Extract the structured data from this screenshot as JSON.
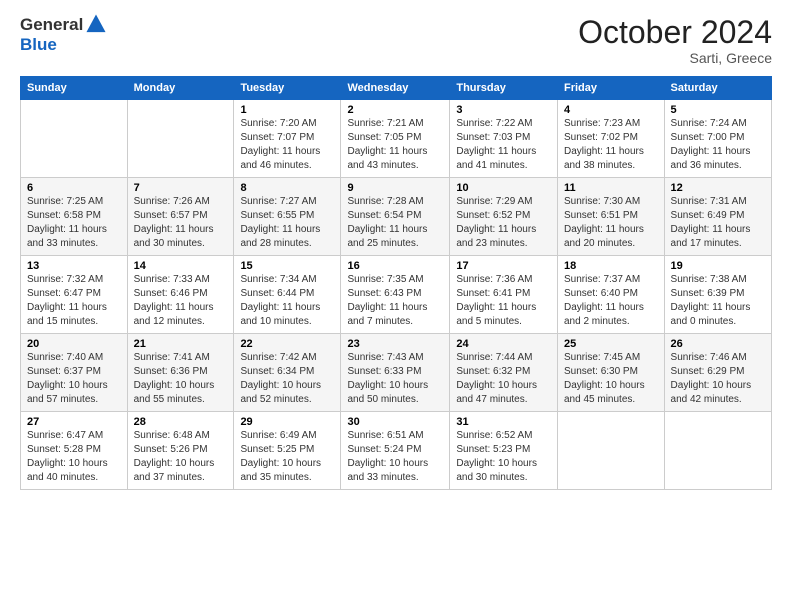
{
  "header": {
    "logo_general": "General",
    "logo_blue": "Blue",
    "title": "October 2024",
    "location": "Sarti, Greece"
  },
  "columns": [
    "Sunday",
    "Monday",
    "Tuesday",
    "Wednesday",
    "Thursday",
    "Friday",
    "Saturday"
  ],
  "weeks": [
    [
      {
        "day": "",
        "info": ""
      },
      {
        "day": "",
        "info": ""
      },
      {
        "day": "1",
        "info": "Sunrise: 7:20 AM\nSunset: 7:07 PM\nDaylight: 11 hours and 46 minutes."
      },
      {
        "day": "2",
        "info": "Sunrise: 7:21 AM\nSunset: 7:05 PM\nDaylight: 11 hours and 43 minutes."
      },
      {
        "day": "3",
        "info": "Sunrise: 7:22 AM\nSunset: 7:03 PM\nDaylight: 11 hours and 41 minutes."
      },
      {
        "day": "4",
        "info": "Sunrise: 7:23 AM\nSunset: 7:02 PM\nDaylight: 11 hours and 38 minutes."
      },
      {
        "day": "5",
        "info": "Sunrise: 7:24 AM\nSunset: 7:00 PM\nDaylight: 11 hours and 36 minutes."
      }
    ],
    [
      {
        "day": "6",
        "info": "Sunrise: 7:25 AM\nSunset: 6:58 PM\nDaylight: 11 hours and 33 minutes."
      },
      {
        "day": "7",
        "info": "Sunrise: 7:26 AM\nSunset: 6:57 PM\nDaylight: 11 hours and 30 minutes."
      },
      {
        "day": "8",
        "info": "Sunrise: 7:27 AM\nSunset: 6:55 PM\nDaylight: 11 hours and 28 minutes."
      },
      {
        "day": "9",
        "info": "Sunrise: 7:28 AM\nSunset: 6:54 PM\nDaylight: 11 hours and 25 minutes."
      },
      {
        "day": "10",
        "info": "Sunrise: 7:29 AM\nSunset: 6:52 PM\nDaylight: 11 hours and 23 minutes."
      },
      {
        "day": "11",
        "info": "Sunrise: 7:30 AM\nSunset: 6:51 PM\nDaylight: 11 hours and 20 minutes."
      },
      {
        "day": "12",
        "info": "Sunrise: 7:31 AM\nSunset: 6:49 PM\nDaylight: 11 hours and 17 minutes."
      }
    ],
    [
      {
        "day": "13",
        "info": "Sunrise: 7:32 AM\nSunset: 6:47 PM\nDaylight: 11 hours and 15 minutes."
      },
      {
        "day": "14",
        "info": "Sunrise: 7:33 AM\nSunset: 6:46 PM\nDaylight: 11 hours and 12 minutes."
      },
      {
        "day": "15",
        "info": "Sunrise: 7:34 AM\nSunset: 6:44 PM\nDaylight: 11 hours and 10 minutes."
      },
      {
        "day": "16",
        "info": "Sunrise: 7:35 AM\nSunset: 6:43 PM\nDaylight: 11 hours and 7 minutes."
      },
      {
        "day": "17",
        "info": "Sunrise: 7:36 AM\nSunset: 6:41 PM\nDaylight: 11 hours and 5 minutes."
      },
      {
        "day": "18",
        "info": "Sunrise: 7:37 AM\nSunset: 6:40 PM\nDaylight: 11 hours and 2 minutes."
      },
      {
        "day": "19",
        "info": "Sunrise: 7:38 AM\nSunset: 6:39 PM\nDaylight: 11 hours and 0 minutes."
      }
    ],
    [
      {
        "day": "20",
        "info": "Sunrise: 7:40 AM\nSunset: 6:37 PM\nDaylight: 10 hours and 57 minutes."
      },
      {
        "day": "21",
        "info": "Sunrise: 7:41 AM\nSunset: 6:36 PM\nDaylight: 10 hours and 55 minutes."
      },
      {
        "day": "22",
        "info": "Sunrise: 7:42 AM\nSunset: 6:34 PM\nDaylight: 10 hours and 52 minutes."
      },
      {
        "day": "23",
        "info": "Sunrise: 7:43 AM\nSunset: 6:33 PM\nDaylight: 10 hours and 50 minutes."
      },
      {
        "day": "24",
        "info": "Sunrise: 7:44 AM\nSunset: 6:32 PM\nDaylight: 10 hours and 47 minutes."
      },
      {
        "day": "25",
        "info": "Sunrise: 7:45 AM\nSunset: 6:30 PM\nDaylight: 10 hours and 45 minutes."
      },
      {
        "day": "26",
        "info": "Sunrise: 7:46 AM\nSunset: 6:29 PM\nDaylight: 10 hours and 42 minutes."
      }
    ],
    [
      {
        "day": "27",
        "info": "Sunrise: 6:47 AM\nSunset: 5:28 PM\nDaylight: 10 hours and 40 minutes."
      },
      {
        "day": "28",
        "info": "Sunrise: 6:48 AM\nSunset: 5:26 PM\nDaylight: 10 hours and 37 minutes."
      },
      {
        "day": "29",
        "info": "Sunrise: 6:49 AM\nSunset: 5:25 PM\nDaylight: 10 hours and 35 minutes."
      },
      {
        "day": "30",
        "info": "Sunrise: 6:51 AM\nSunset: 5:24 PM\nDaylight: 10 hours and 33 minutes."
      },
      {
        "day": "31",
        "info": "Sunrise: 6:52 AM\nSunset: 5:23 PM\nDaylight: 10 hours and 30 minutes."
      },
      {
        "day": "",
        "info": ""
      },
      {
        "day": "",
        "info": ""
      }
    ]
  ]
}
